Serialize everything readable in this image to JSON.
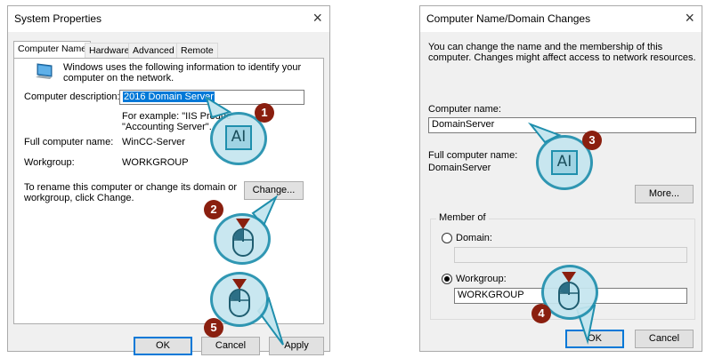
{
  "system_properties": {
    "title": "System Properties",
    "close_glyph": "×",
    "tabs": [
      "Computer Name",
      "Hardware",
      "Advanced",
      "Remote"
    ],
    "info_text": "Windows uses the following information to identify your computer on the network.",
    "description_label": "Computer description:",
    "description_value": "2016 Domain Server",
    "example_text_1": "For example: \"IIS Produc",
    "example_text_2": "\"Accounting Server\".",
    "full_name_label": "Full computer name:",
    "full_name_value": "WinCC-Server",
    "workgroup_label": "Workgroup:",
    "workgroup_value": "WORKGROUP",
    "rename_text_1": "To rename this computer or change its domain or",
    "rename_text_2": "workgroup, click Change.",
    "change_button": "Change...",
    "ok_button": "OK",
    "cancel_button": "Cancel",
    "apply_button": "Apply"
  },
  "domain_changes": {
    "title": "Computer Name/Domain Changes",
    "close_glyph": "×",
    "intro_1": "You can change the name and the membership of this",
    "intro_2": "computer. Changes might affect access to network resources.",
    "computer_name_label": "Computer name:",
    "computer_name_value": "DomainServer",
    "full_name_label": "Full computer name:",
    "full_name_value": "DomainServer",
    "more_button": "More...",
    "member_of_label": "Member of",
    "domain_label": "Domain:",
    "domain_value": "",
    "workgroup_label": "Workgroup:",
    "workgroup_value": "WORKGROUP",
    "ok_button": "OK",
    "cancel_button": "Cancel"
  },
  "callouts": {
    "step1": "1",
    "step2": "2",
    "step3": "3",
    "step4": "4",
    "step5": "5",
    "text_cursor_glyph": "AI"
  },
  "colors": {
    "callout_fill": "#c5e6ef",
    "callout_border": "#1f8fad",
    "badge": "#8a1f0f",
    "selection": "#0078d7"
  }
}
